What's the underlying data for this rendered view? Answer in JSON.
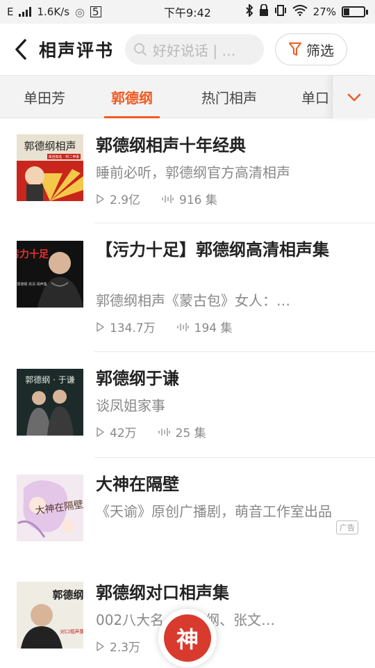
{
  "status_bar": {
    "carrier": "E",
    "net_speed": "1.6K/s",
    "time": "下午9:42",
    "battery": "27%",
    "battery_level": 0.27
  },
  "header": {
    "title": "相声评书",
    "search_placeholder": "好好说话 | …",
    "filter_label": "筛选"
  },
  "tabs": [
    {
      "label": "单田芳",
      "active": false
    },
    {
      "label": "郭德纲",
      "active": true
    },
    {
      "label": "热门相声",
      "active": false
    },
    {
      "label": "单口",
      "active": false
    }
  ],
  "list": [
    {
      "title": "郭德纲相声十年经典",
      "desc": "睡前必听，郭德纲官方高清相声",
      "plays": "2.9亿",
      "episodes": "916 集",
      "cover_text": "郭德纲相声",
      "cover_sub": "来自知名 · 听二甲系"
    },
    {
      "title": "【污力十足】郭德纲高清相声集",
      "desc": "郭德纲相声《蒙古包》女人：…",
      "plays": "134.7万",
      "episodes": "194 集",
      "cover_text": "污力十足",
      "cover_sub": "郭德纲 高清 相声集"
    },
    {
      "title": "郭德纲于谦",
      "desc": "谈凤姐家事",
      "plays": "42万",
      "episodes": "25 集",
      "cover_text": "郭德纲 · 于谦"
    },
    {
      "title": "大神在隔壁",
      "desc": "《天谕》原创广播剧，萌音工作室出品",
      "ad_label": "广告",
      "cover_text": "大神在隔壁"
    },
    {
      "title": "郭德纲对口相声集",
      "desc": "002八大名…郭德纲、张文…",
      "plays": "2.3万",
      "cover_text": "郭德纲",
      "cover_sub": "对口相声集"
    }
  ],
  "player": {
    "label": "神"
  },
  "colors": {
    "accent": "#ef5a23",
    "tab_bg": "#f3f3f3",
    "text_secondary": "#888888"
  }
}
